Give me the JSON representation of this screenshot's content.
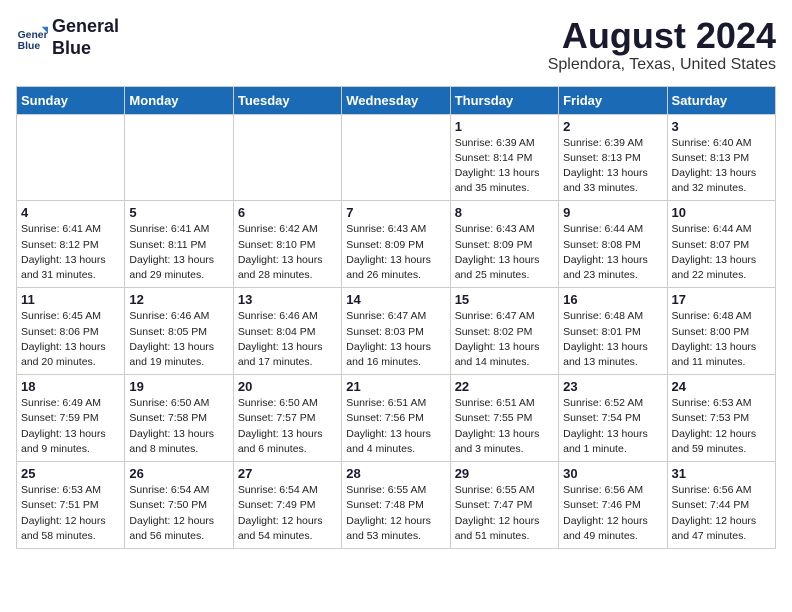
{
  "logo": {
    "line1": "General",
    "line2": "Blue"
  },
  "title": "August 2024",
  "subtitle": "Splendora, Texas, United States",
  "days_header": [
    "Sunday",
    "Monday",
    "Tuesday",
    "Wednesday",
    "Thursday",
    "Friday",
    "Saturday"
  ],
  "weeks": [
    [
      {
        "day": "",
        "info": ""
      },
      {
        "day": "",
        "info": ""
      },
      {
        "day": "",
        "info": ""
      },
      {
        "day": "",
        "info": ""
      },
      {
        "day": "1",
        "info": "Sunrise: 6:39 AM\nSunset: 8:14 PM\nDaylight: 13 hours\nand 35 minutes."
      },
      {
        "day": "2",
        "info": "Sunrise: 6:39 AM\nSunset: 8:13 PM\nDaylight: 13 hours\nand 33 minutes."
      },
      {
        "day": "3",
        "info": "Sunrise: 6:40 AM\nSunset: 8:13 PM\nDaylight: 13 hours\nand 32 minutes."
      }
    ],
    [
      {
        "day": "4",
        "info": "Sunrise: 6:41 AM\nSunset: 8:12 PM\nDaylight: 13 hours\nand 31 minutes."
      },
      {
        "day": "5",
        "info": "Sunrise: 6:41 AM\nSunset: 8:11 PM\nDaylight: 13 hours\nand 29 minutes."
      },
      {
        "day": "6",
        "info": "Sunrise: 6:42 AM\nSunset: 8:10 PM\nDaylight: 13 hours\nand 28 minutes."
      },
      {
        "day": "7",
        "info": "Sunrise: 6:43 AM\nSunset: 8:09 PM\nDaylight: 13 hours\nand 26 minutes."
      },
      {
        "day": "8",
        "info": "Sunrise: 6:43 AM\nSunset: 8:09 PM\nDaylight: 13 hours\nand 25 minutes."
      },
      {
        "day": "9",
        "info": "Sunrise: 6:44 AM\nSunset: 8:08 PM\nDaylight: 13 hours\nand 23 minutes."
      },
      {
        "day": "10",
        "info": "Sunrise: 6:44 AM\nSunset: 8:07 PM\nDaylight: 13 hours\nand 22 minutes."
      }
    ],
    [
      {
        "day": "11",
        "info": "Sunrise: 6:45 AM\nSunset: 8:06 PM\nDaylight: 13 hours\nand 20 minutes."
      },
      {
        "day": "12",
        "info": "Sunrise: 6:46 AM\nSunset: 8:05 PM\nDaylight: 13 hours\nand 19 minutes."
      },
      {
        "day": "13",
        "info": "Sunrise: 6:46 AM\nSunset: 8:04 PM\nDaylight: 13 hours\nand 17 minutes."
      },
      {
        "day": "14",
        "info": "Sunrise: 6:47 AM\nSunset: 8:03 PM\nDaylight: 13 hours\nand 16 minutes."
      },
      {
        "day": "15",
        "info": "Sunrise: 6:47 AM\nSunset: 8:02 PM\nDaylight: 13 hours\nand 14 minutes."
      },
      {
        "day": "16",
        "info": "Sunrise: 6:48 AM\nSunset: 8:01 PM\nDaylight: 13 hours\nand 13 minutes."
      },
      {
        "day": "17",
        "info": "Sunrise: 6:48 AM\nSunset: 8:00 PM\nDaylight: 13 hours\nand 11 minutes."
      }
    ],
    [
      {
        "day": "18",
        "info": "Sunrise: 6:49 AM\nSunset: 7:59 PM\nDaylight: 13 hours\nand 9 minutes."
      },
      {
        "day": "19",
        "info": "Sunrise: 6:50 AM\nSunset: 7:58 PM\nDaylight: 13 hours\nand 8 minutes."
      },
      {
        "day": "20",
        "info": "Sunrise: 6:50 AM\nSunset: 7:57 PM\nDaylight: 13 hours\nand 6 minutes."
      },
      {
        "day": "21",
        "info": "Sunrise: 6:51 AM\nSunset: 7:56 PM\nDaylight: 13 hours\nand 4 minutes."
      },
      {
        "day": "22",
        "info": "Sunrise: 6:51 AM\nSunset: 7:55 PM\nDaylight: 13 hours\nand 3 minutes."
      },
      {
        "day": "23",
        "info": "Sunrise: 6:52 AM\nSunset: 7:54 PM\nDaylight: 13 hours\nand 1 minute."
      },
      {
        "day": "24",
        "info": "Sunrise: 6:53 AM\nSunset: 7:53 PM\nDaylight: 12 hours\nand 59 minutes."
      }
    ],
    [
      {
        "day": "25",
        "info": "Sunrise: 6:53 AM\nSunset: 7:51 PM\nDaylight: 12 hours\nand 58 minutes."
      },
      {
        "day": "26",
        "info": "Sunrise: 6:54 AM\nSunset: 7:50 PM\nDaylight: 12 hours\nand 56 minutes."
      },
      {
        "day": "27",
        "info": "Sunrise: 6:54 AM\nSunset: 7:49 PM\nDaylight: 12 hours\nand 54 minutes."
      },
      {
        "day": "28",
        "info": "Sunrise: 6:55 AM\nSunset: 7:48 PM\nDaylight: 12 hours\nand 53 minutes."
      },
      {
        "day": "29",
        "info": "Sunrise: 6:55 AM\nSunset: 7:47 PM\nDaylight: 12 hours\nand 51 minutes."
      },
      {
        "day": "30",
        "info": "Sunrise: 6:56 AM\nSunset: 7:46 PM\nDaylight: 12 hours\nand 49 minutes."
      },
      {
        "day": "31",
        "info": "Sunrise: 6:56 AM\nSunset: 7:44 PM\nDaylight: 12 hours\nand 47 minutes."
      }
    ]
  ]
}
